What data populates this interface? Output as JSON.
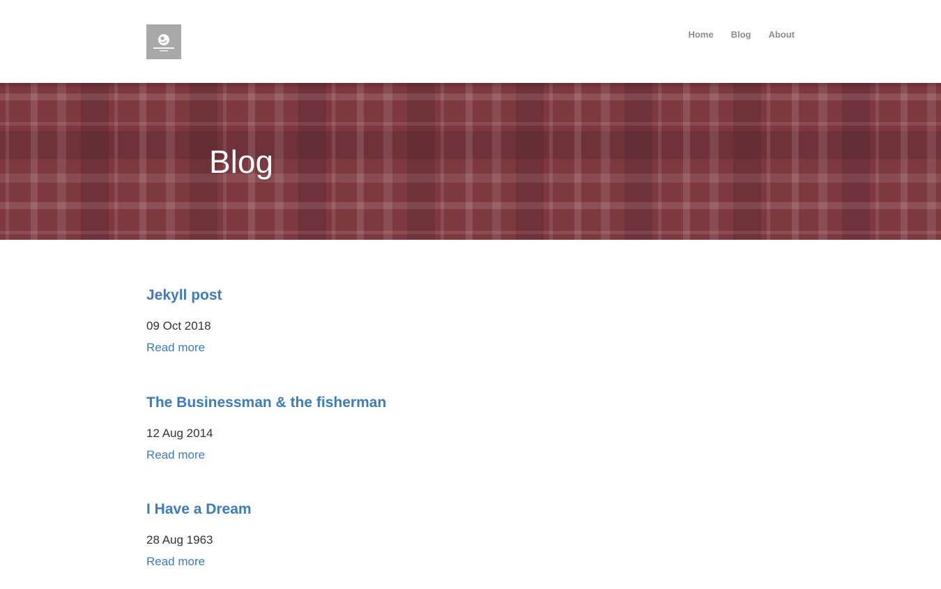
{
  "header": {
    "logo": {
      "icon": "site-logo-icon",
      "background": "#a9a9a9"
    },
    "nav": [
      {
        "label": "Home"
      },
      {
        "label": "Blog"
      },
      {
        "label": "About"
      }
    ]
  },
  "hero": {
    "title": "Blog",
    "background": "#7d3840"
  },
  "posts": [
    {
      "title": "Jekyll post",
      "date": "09 Oct 2018",
      "read_more": "Read more"
    },
    {
      "title": "The Businessman & the fisherman",
      "date": "12 Aug 2014",
      "read_more": "Read more"
    },
    {
      "title": "I Have a Dream",
      "date": "28 Aug 1963",
      "read_more": "Read more"
    }
  ],
  "colors": {
    "link": "#3b7cc1",
    "nav_text": "#8c8c8c",
    "body_text": "#333333"
  }
}
